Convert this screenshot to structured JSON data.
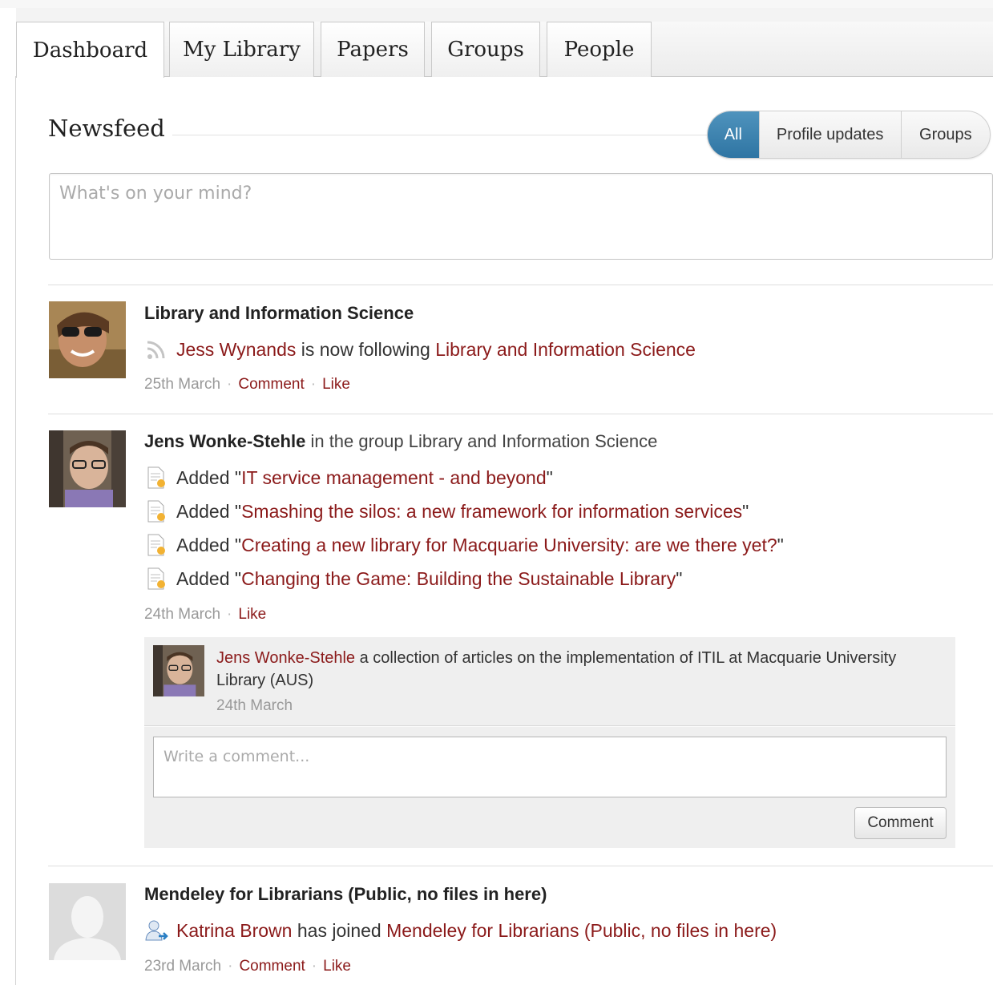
{
  "tabs": [
    "Dashboard",
    "My Library",
    "Papers",
    "Groups",
    "People"
  ],
  "newsfeed": {
    "title": "Newsfeed",
    "filters": [
      "All",
      "Profile updates",
      "Groups"
    ],
    "active_filter": "All",
    "status_placeholder": "What's on your mind?"
  },
  "items": [
    {
      "headline": "Library and Information Science",
      "actor": "Jess Wynands",
      "action": "is now following",
      "target": "Library and Information Science",
      "date": "25th March",
      "comment_label": "Comment",
      "like_label": "Like",
      "icon": "rss-icon"
    },
    {
      "actor": "Jens Wonke-Stehle",
      "context": "in the group Library and Information Science",
      "added_prefix": "Added",
      "papers": [
        "IT service management - and beyond",
        "Smashing the silos: a new framework for information services",
        "Creating a new library for Macquarie University: are we there yet?",
        "Changing the Game: Building the Sustainable Library"
      ],
      "date": "24th March",
      "like_label": "Like",
      "icon": "document-add-icon",
      "comment": {
        "author": "Jens Wonke-Stehle",
        "text": "a collection of articles on the implementation of ITIL at Macquarie University Library (AUS)",
        "date": "24th March",
        "input_placeholder": "Write a comment...",
        "button_label": "Comment"
      }
    },
    {
      "headline": "Mendeley for Librarians (Public, no files in here)",
      "actor": "Katrina Brown",
      "action": "has joined",
      "target": "Mendeley for Librarians (Public, no files in here)",
      "date": "23rd March",
      "comment_label": "Comment",
      "like_label": "Like",
      "icon": "user-join-icon"
    }
  ],
  "colors": {
    "link": "#8b1a1a",
    "active_filter": "#3a80ad",
    "muted": "#999999"
  }
}
